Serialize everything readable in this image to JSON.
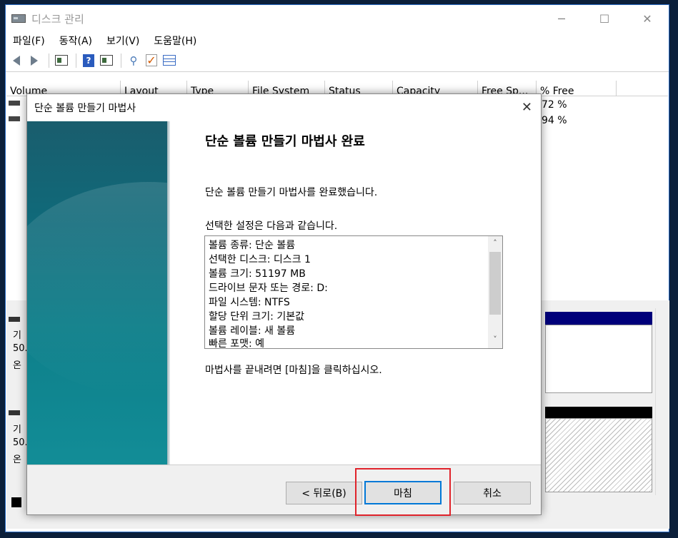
{
  "app": {
    "title": "디스크 관리",
    "menus": [
      "파일(F)",
      "동작(A)",
      "보기(V)",
      "도움말(H)"
    ],
    "minimize_glyph": "─",
    "maximize_glyph": "☐",
    "close_glyph": "✕"
  },
  "volume_list": {
    "columns": [
      "Volume",
      "Layout",
      "Type",
      "File System",
      "Status",
      "Capacity",
      "Free Sp...",
      "% Free"
    ],
    "rows_pct_free": [
      "72 %",
      "94 %"
    ]
  },
  "lower_panel": {
    "disk_labels_1": [
      "기",
      "50.",
      "온"
    ],
    "disk_labels_2": [
      "기",
      "50.",
      "온"
    ]
  },
  "dialog": {
    "title": "단순 볼륨 만들기 마법사",
    "close_glyph": "✕",
    "heading": "단순 볼륨 만들기 마법사 완료",
    "completed_text": "단순 볼륨 만들기 마법사를 완료했습니다.",
    "settings_intro": "선택한 설정은 다음과 같습니다.",
    "summary_lines": [
      "볼륨 종류: 단순 볼륨",
      "선택한 디스크: 디스크 1",
      "볼륨 크기: 51197 MB",
      "드라이브 문자 또는 경로: D:",
      "파일 시스템: NTFS",
      "할당 단위 크기: 기본값",
      "볼륨 레이블: 새 볼륨",
      "빠른 포맷: 예"
    ],
    "finish_instruction": "마법사를 끝내려면 [마침]을 클릭하십시오.",
    "back_button": "< 뒤로(B)",
    "finish_button": "마침",
    "cancel_button": "취소",
    "scroll_up": "˄",
    "scroll_down": "˅"
  },
  "colors": {
    "banner": "#0e7f8a",
    "highlight": "#e0232b",
    "primary_border": "#0078d7"
  }
}
